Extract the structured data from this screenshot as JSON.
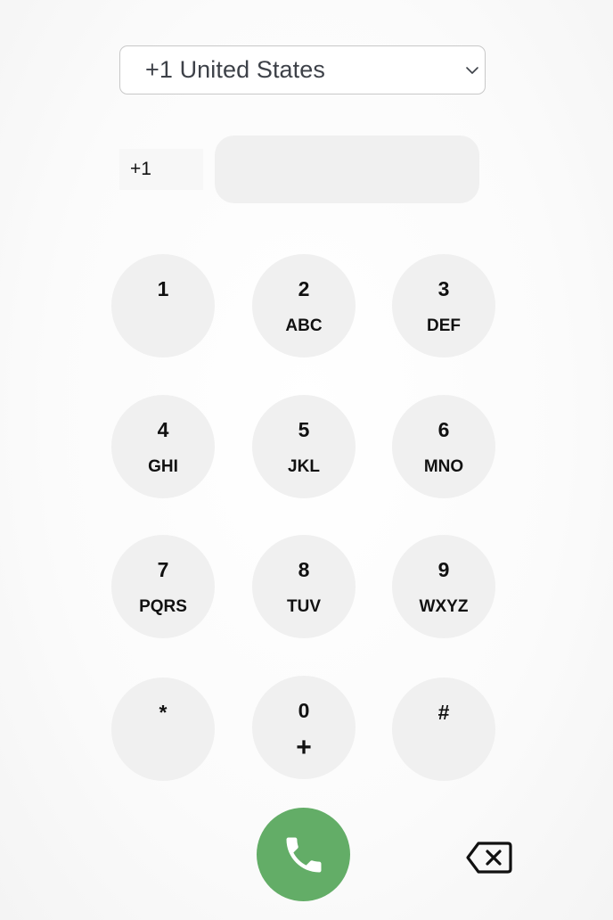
{
  "country_select": {
    "selected": "+1 United States",
    "icon": "chevron-down-icon"
  },
  "phone": {
    "prefix": "+1",
    "value": "",
    "placeholder": ""
  },
  "keypad": {
    "keys": [
      {
        "digit": "1",
        "letters": ""
      },
      {
        "digit": "2",
        "letters": "ABC"
      },
      {
        "digit": "3",
        "letters": "DEF"
      },
      {
        "digit": "4",
        "letters": "GHI"
      },
      {
        "digit": "5",
        "letters": "JKL"
      },
      {
        "digit": "6",
        "letters": "MNO"
      },
      {
        "digit": "7",
        "letters": "PQRS"
      },
      {
        "digit": "8",
        "letters": "TUV"
      },
      {
        "digit": "9",
        "letters": "WXYZ"
      },
      {
        "digit": "*",
        "letters": ""
      },
      {
        "digit": "0",
        "letters": "+"
      },
      {
        "digit": "#",
        "letters": ""
      }
    ]
  },
  "actions": {
    "call_icon": "phone-icon",
    "backspace_icon": "backspace-icon"
  },
  "colors": {
    "call_green": "#63ad67",
    "key_bg": "#f0f0f0"
  }
}
